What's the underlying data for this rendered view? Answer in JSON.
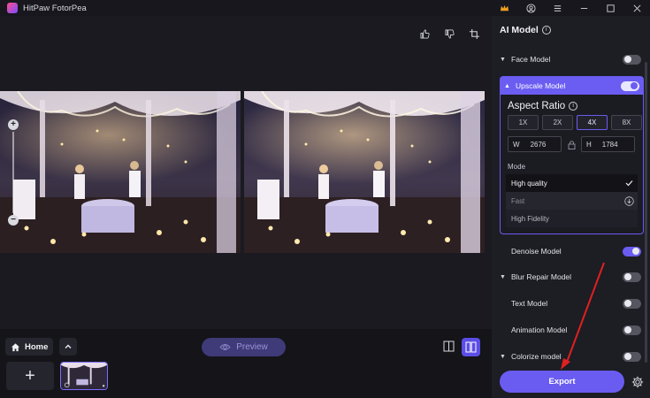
{
  "window": {
    "title": "HitPaw FotorPea"
  },
  "panel": {
    "title": "AI Model",
    "models": [
      {
        "label": "Face Model",
        "expanded": false,
        "enabled": false
      },
      {
        "label": "Upscale Model",
        "expanded": true,
        "enabled": true
      },
      {
        "label": "Denoise Model",
        "expanded": false,
        "enabled": true
      },
      {
        "label": "Blur Repair Model",
        "expanded": false,
        "enabled": false
      },
      {
        "label": "Text Model",
        "expanded": false,
        "enabled": false
      },
      {
        "label": "Animation Model",
        "expanded": false,
        "enabled": false
      },
      {
        "label": "Colorize model",
        "expanded": false,
        "enabled": false
      }
    ],
    "upscale": {
      "aspect_title": "Aspect Ratio",
      "ratios": [
        "1X",
        "2X",
        "4X",
        "8X"
      ],
      "selected_ratio": "4X",
      "width_label": "W",
      "width_value": "2676",
      "height_label": "H",
      "height_value": "1784",
      "mode_title": "Mode",
      "modes": [
        "High quality",
        "Fast",
        "High Fidelity"
      ],
      "selected_mode": "High quality"
    },
    "export_label": "Export"
  },
  "bottom": {
    "home_label": "Home",
    "preview_label": "Preview",
    "add_label": "+"
  },
  "colors": {
    "accent": "#6a5cf0",
    "annotation": "#e02020"
  }
}
